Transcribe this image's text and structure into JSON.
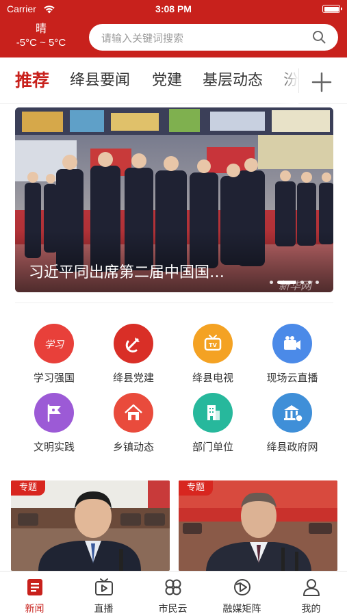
{
  "status_bar": {
    "carrier": "Carrier",
    "time": "3:08 PM"
  },
  "header": {
    "weather": {
      "condition": "晴",
      "temperature": "-5°C ~ 5°C"
    },
    "search": {
      "placeholder": "请输入关键词搜索",
      "icon": "search-icon"
    }
  },
  "tabs": [
    {
      "label": "推荐",
      "active": true
    },
    {
      "label": "绛县要闻",
      "active": false
    },
    {
      "label": "党建",
      "active": false
    },
    {
      "label": "基层动态",
      "active": false
    },
    {
      "label": "汾",
      "active": false
    }
  ],
  "add_tab_icon": "plus-icon",
  "banner": {
    "caption": "习近平同出席第二届中国国…",
    "watermark": "新华网",
    "slide_count": 4,
    "active_slide": 1
  },
  "grid": [
    {
      "label": "学习强国",
      "icon": "xuexi-qiangguo-icon",
      "color": "#e8403a"
    },
    {
      "label": "绛县党建",
      "icon": "party-emblem-icon",
      "color": "#d92f27"
    },
    {
      "label": "绛县电视",
      "icon": "tv-icon",
      "color": "#f4a223"
    },
    {
      "label": "现场云直播",
      "icon": "video-camera-icon",
      "color": "#4b8ae8"
    },
    {
      "label": "文明实践",
      "icon": "flag-icon",
      "color": "#9c5ad6"
    },
    {
      "label": "乡镇动态",
      "icon": "town-house-icon",
      "color": "#e94b3c"
    },
    {
      "label": "部门单位",
      "icon": "building-icon",
      "color": "#27b89c"
    },
    {
      "label": "绛县政府网",
      "icon": "government-icon",
      "color": "#3f8fd8"
    }
  ],
  "cards": [
    {
      "badge": "专题"
    },
    {
      "badge": "专题"
    }
  ],
  "bottom_nav": [
    {
      "label": "新闻",
      "icon": "news-icon",
      "active": true
    },
    {
      "label": "直播",
      "icon": "live-tv-icon",
      "active": false
    },
    {
      "label": "市民云",
      "icon": "citizen-cloud-icon",
      "active": false
    },
    {
      "label": "融媒矩阵",
      "icon": "media-matrix-icon",
      "active": false
    },
    {
      "label": "我的",
      "icon": "profile-icon",
      "active": false
    }
  ],
  "colors": {
    "brand": "#c8211c",
    "active_text": "#c8211c",
    "badge": "#d8261f"
  }
}
